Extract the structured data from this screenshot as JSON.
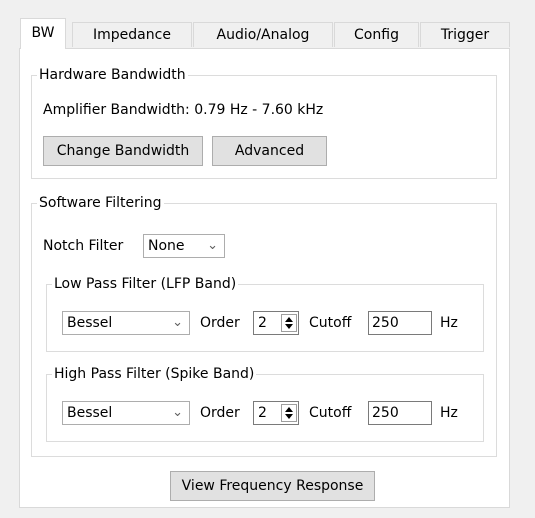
{
  "tabs": [
    {
      "label": "BW",
      "active": true
    },
    {
      "label": "Impedance",
      "active": false
    },
    {
      "label": "Audio/Analog",
      "active": false
    },
    {
      "label": "Config",
      "active": false
    },
    {
      "label": "Trigger",
      "active": false
    }
  ],
  "hardware": {
    "title": "Hardware Bandwidth",
    "amplifier_label": "Amplifier Bandwidth: 0.79 Hz - 7.60 kHz",
    "change_button": "Change Bandwidth",
    "advanced_button": "Advanced"
  },
  "software": {
    "title": "Software Filtering",
    "notch_label": "Notch Filter",
    "notch_value": "None",
    "lowpass": {
      "title": "Low Pass Filter (LFP Band)",
      "type": "Bessel",
      "order_label": "Order",
      "order_value": "2",
      "cutoff_label": "Cutoff",
      "cutoff_value": "250",
      "unit": "Hz"
    },
    "highpass": {
      "title": "High Pass Filter (Spike Band)",
      "type": "Bessel",
      "order_label": "Order",
      "order_value": "2",
      "cutoff_label": "Cutoff",
      "cutoff_value": "250",
      "unit": "Hz"
    }
  },
  "view_response_button": "View Frequency Response",
  "icons": {
    "dropdown": "chevron-down-icon",
    "spinner": "spin-arrows-icon"
  }
}
